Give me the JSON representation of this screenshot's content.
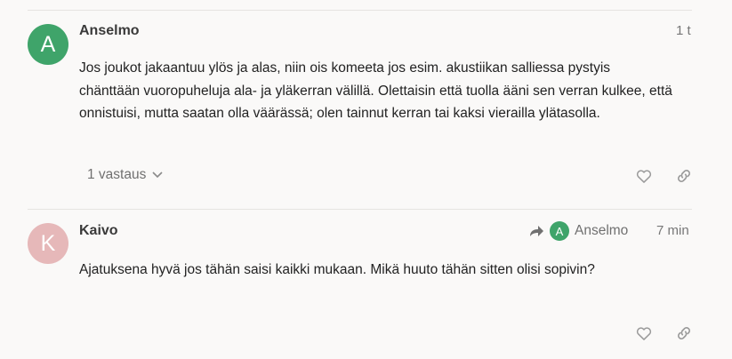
{
  "posts": [
    {
      "avatar_letter": "A",
      "avatar_color": "#3fa46a",
      "username": "Anselmo",
      "time": "1 t",
      "paragraph_lines": [
        "Jos joukot jakaantuu ylös ja alas, niin ois komeeta jos esim. akustiikan salliessa pystyis",
        "chänttään vuoropuheluja ala- ja yläkerran välillä. Olettaisin että tuolla ääni sen verran kulkee, että",
        "onnistuisi, mutta saatan olla väärässä; olen tainnut kerran tai kaksi vierailla ylätasolla."
      ],
      "replies_label": "1 vastaus",
      "icons": [
        "heart-icon",
        "link-icon"
      ]
    },
    {
      "avatar_letter": "K",
      "avatar_color": "#e6b8b9",
      "username": "Kaivo",
      "reply_to_letter": "A",
      "reply_to_name": "Anselmo",
      "time": "7 min",
      "paragraph_lines": [
        "Ajatuksena hyvä jos tähän saisi kaikki mukaan. Mikä huuto tähän sitten olisi sopivin?"
      ],
      "icons": [
        "heart-icon",
        "link-icon"
      ]
    }
  ]
}
